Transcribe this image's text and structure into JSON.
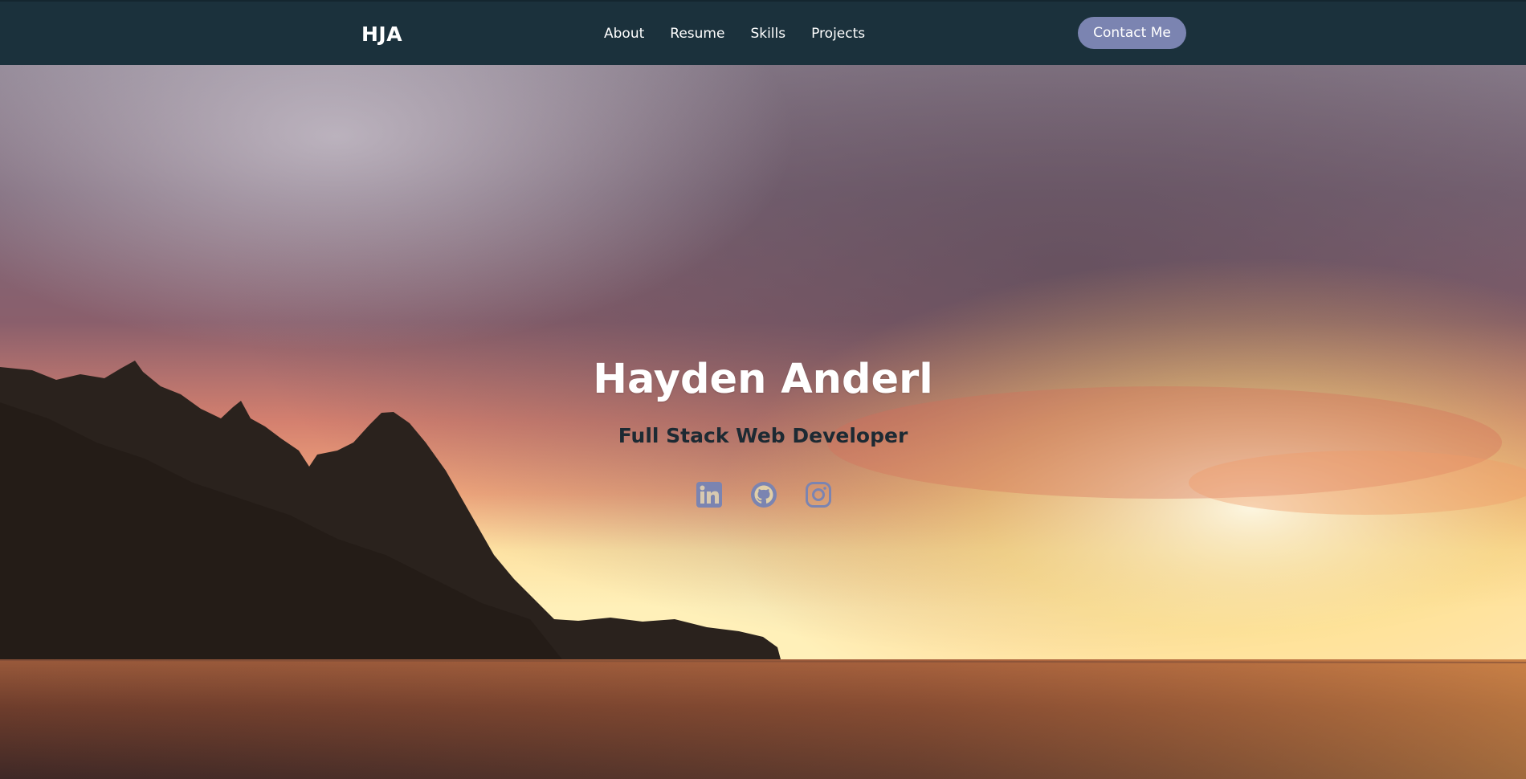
{
  "nav": {
    "logo": "HJA",
    "links": [
      {
        "label": "About"
      },
      {
        "label": "Resume"
      },
      {
        "label": "Skills"
      },
      {
        "label": "Projects"
      }
    ],
    "contact_label": "Contact Me"
  },
  "hero": {
    "name": "Hayden Anderl",
    "subtitle": "Full Stack Web Developer",
    "socials": [
      {
        "icon": "linkedin-icon"
      },
      {
        "icon": "github-icon"
      },
      {
        "icon": "instagram-icon"
      }
    ]
  },
  "colors": {
    "navbar": "#1b313c",
    "accent": "#7b84b1",
    "title_text": "#ffffff",
    "subtitle_text": "#1d2a33"
  }
}
